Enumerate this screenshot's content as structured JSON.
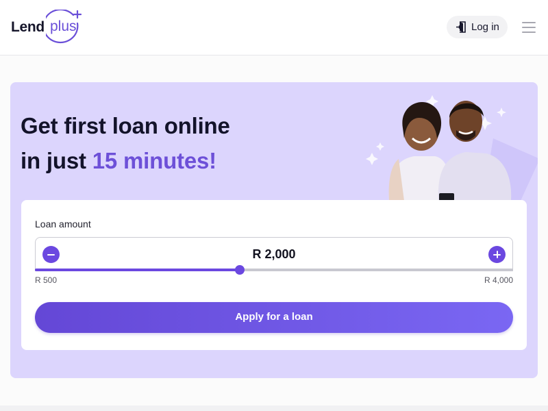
{
  "header": {
    "logo": {
      "word": "Lend",
      "badge": "plus"
    },
    "login_label": "Log in",
    "icons": {
      "login": "door-enter-icon",
      "menu": "hamburger-menu-icon"
    }
  },
  "hero": {
    "headline_line1": "Get first loan online",
    "headline_line2_prefix": "in just",
    "headline_line2_accent": "15 minutes!",
    "illustration": "smiling-couple-looking-at-phone"
  },
  "loan_form": {
    "amount_label": "Loan amount",
    "amount_value": "R 2,000",
    "range_min_label": "R 500",
    "range_max_label": "R 4,000",
    "slider": {
      "min": 500,
      "max": 4000,
      "value": 2000
    },
    "icons": {
      "decrease": "minus-icon",
      "increase": "plus-icon"
    },
    "apply_label": "Apply for a loan"
  },
  "colors": {
    "brand": "#6b48e0",
    "hero_background": "#dcd5fd",
    "accent_text": "#6d50d8",
    "header_background": "#ffffff"
  }
}
